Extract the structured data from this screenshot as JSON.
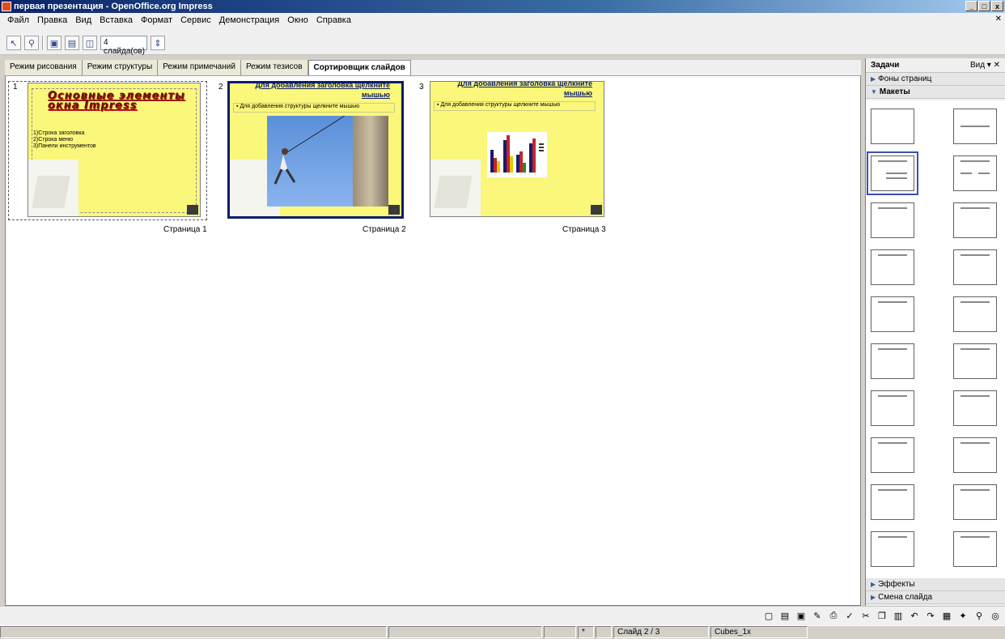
{
  "window": {
    "title": "первая презентация - OpenOffice.org Impress",
    "buttons": [
      "_",
      "□",
      "x"
    ]
  },
  "menu": [
    "Файл",
    "Правка",
    "Вид",
    "Вставка",
    "Формат",
    "Сервис",
    "Демонстрация",
    "Окно",
    "Справка"
  ],
  "toolbar": {
    "slide_count": "4 слайда(ов)"
  },
  "tabs": [
    "Режим рисования",
    "Режим структуры",
    "Режим примечаний",
    "Режим тезисов",
    "Сортировщик слайдов"
  ],
  "slides": [
    {
      "num": "1",
      "title": "Основные элементы окна Impress",
      "body": [
        "1)Строка заголовка",
        "2)Строка меню",
        "3)Панели инструментов"
      ],
      "label": "Страница 1"
    },
    {
      "num": "2",
      "title": "Для добавления заголовка щелкните мышью",
      "bullet": "Для добавления структуры щелкните мышью",
      "label": "Страница 2"
    },
    {
      "num": "3",
      "title": "Для добавления заголовка щелкните мышью",
      "bullet": "Для добавления структуры щелкните мышью",
      "label": "Страница 3"
    }
  ],
  "taskpane": {
    "title": "Задачи",
    "view": "Вид",
    "sections": {
      "backgrounds": "Фоны страниц",
      "layouts": "Макеты",
      "effects": "Эффекты",
      "transition": "Смена слайда"
    }
  },
  "status": {
    "slide": "Слайд 2 / 3",
    "design": "Cubes_1x"
  }
}
